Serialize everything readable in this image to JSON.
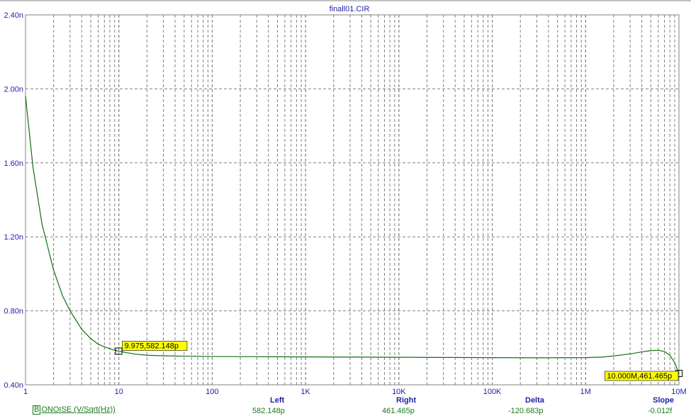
{
  "window": {
    "title": "finall01.CIR"
  },
  "colors": {
    "trace": "#107010",
    "axis_text": "#1f1fa8",
    "grid": "#808080",
    "frame": "#808080",
    "label_bg": "#ffff00",
    "readout_header": "#1f1fa8",
    "readout_value": "#1a7a1a"
  },
  "chart_data": {
    "type": "line",
    "title": "finall01.CIR",
    "xscale": "log",
    "xlim": [
      1,
      10000000
    ],
    "ylim": [
      0.4,
      2.4
    ],
    "x_ticks": [
      {
        "v": 1,
        "label": "1"
      },
      {
        "v": 10,
        "label": "10"
      },
      {
        "v": 100,
        "label": "100"
      },
      {
        "v": 1000,
        "label": "1K"
      },
      {
        "v": 10000,
        "label": "10K"
      },
      {
        "v": 100000,
        "label": "100K"
      },
      {
        "v": 1000000,
        "label": "1M"
      },
      {
        "v": 10000000,
        "label": "10M"
      }
    ],
    "y_ticks": [
      {
        "v": 0.4,
        "label": "0.40n"
      },
      {
        "v": 0.8,
        "label": "0.80n"
      },
      {
        "v": 1.2,
        "label": "1.20n"
      },
      {
        "v": 1.6,
        "label": "1.60n"
      },
      {
        "v": 2.0,
        "label": "2.00n"
      },
      {
        "v": 2.4,
        "label": "2.40n"
      }
    ],
    "grid": true,
    "series": [
      {
        "name": "ONOISE (V/Sqrt(Hz))",
        "x": [
          1,
          1.2,
          1.5,
          2,
          2.5,
          3,
          4,
          5,
          6,
          7,
          8,
          9,
          10,
          12,
          15,
          20,
          30,
          50,
          100,
          300,
          1000,
          3000,
          10000,
          30000,
          100000,
          300000,
          1000000,
          1500000,
          2000000,
          3000000,
          4000000,
          5000000,
          6000000,
          7000000,
          8000000,
          9000000,
          10000000
        ],
        "y": [
          1.96,
          1.58,
          1.27,
          1.02,
          0.88,
          0.8,
          0.7,
          0.65,
          0.62,
          0.605,
          0.595,
          0.587,
          0.582,
          0.574,
          0.566,
          0.56,
          0.557,
          0.555,
          0.553,
          0.552,
          0.551,
          0.55,
          0.549,
          0.548,
          0.547,
          0.546,
          0.547,
          0.55,
          0.556,
          0.567,
          0.578,
          0.585,
          0.587,
          0.58,
          0.56,
          0.52,
          0.461
        ]
      }
    ],
    "cursors": [
      {
        "x": 9.975,
        "y": 0.582,
        "label": "9.975,582.148p"
      },
      {
        "x": 10000000,
        "y": 0.4615,
        "label": "10.000M,461.465p"
      }
    ]
  },
  "readouts": {
    "left": {
      "header": "Left",
      "value": "582.148p"
    },
    "right": {
      "header": "Right",
      "value": "461.465p"
    },
    "delta": {
      "header": "Delta",
      "value": "-120.683p"
    },
    "slope": {
      "header": "Slope",
      "value": "-0.012f"
    }
  },
  "legend": {
    "marker": "B",
    "label": "ONOISE (V/Sqrt(Hz))"
  }
}
